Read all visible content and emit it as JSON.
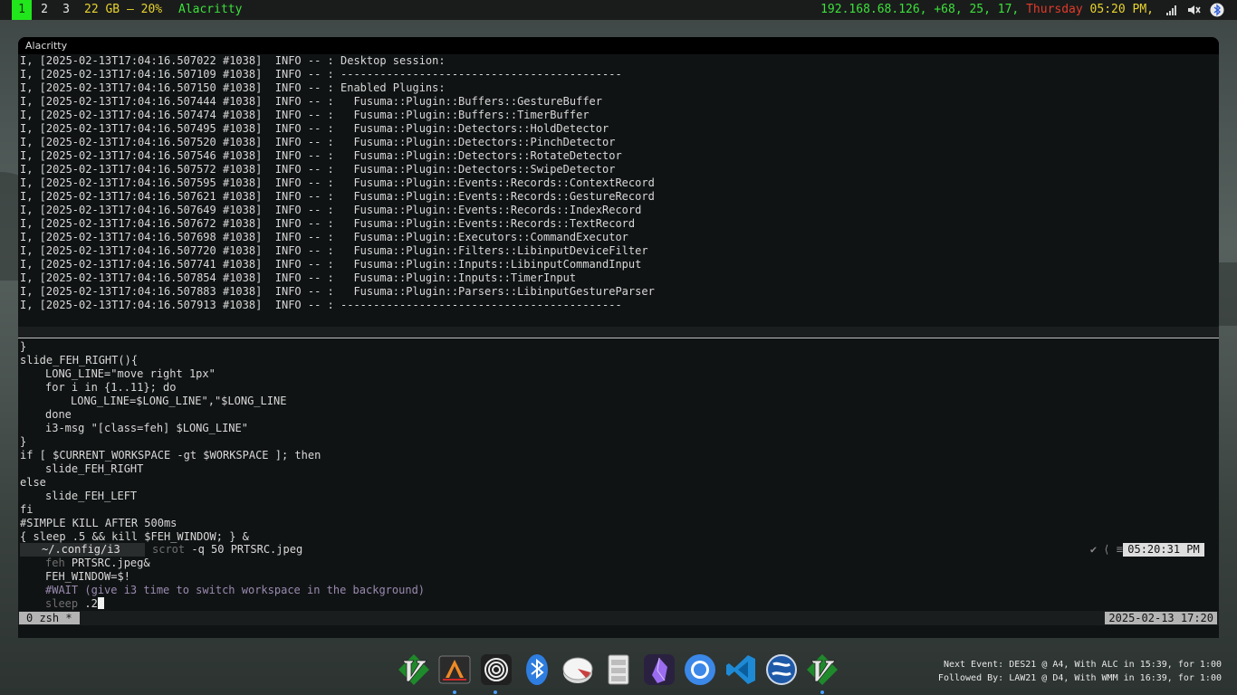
{
  "topbar": {
    "workspaces": [
      "1",
      "2",
      "3"
    ],
    "active_workspace": "1",
    "memory": "22 GB – 20%",
    "window_title": "Alacritty",
    "ip": "192.168.68.126,",
    "weather": " +68, 25, 17,",
    "day": " Thursday",
    "time": " 05:20 PM,",
    "tray_icons": [
      "signal-icon",
      "volume-muted-icon",
      "bluetooth-icon"
    ]
  },
  "window": {
    "title": "Alacritty"
  },
  "log_lines": [
    "I, [2025-02-13T17:04:16.507022 #1038]  INFO -- : Desktop session:",
    "I, [2025-02-13T17:04:16.507109 #1038]  INFO -- : -------------------------------------------",
    "I, [2025-02-13T17:04:16.507150 #1038]  INFO -- : Enabled Plugins:",
    "I, [2025-02-13T17:04:16.507444 #1038]  INFO -- :   Fusuma::Plugin::Buffers::GestureBuffer",
    "I, [2025-02-13T17:04:16.507474 #1038]  INFO -- :   Fusuma::Plugin::Buffers::TimerBuffer",
    "I, [2025-02-13T17:04:16.507495 #1038]  INFO -- :   Fusuma::Plugin::Detectors::HoldDetector",
    "I, [2025-02-13T17:04:16.507520 #1038]  INFO -- :   Fusuma::Plugin::Detectors::PinchDetector",
    "I, [2025-02-13T17:04:16.507546 #1038]  INFO -- :   Fusuma::Plugin::Detectors::RotateDetector",
    "I, [2025-02-13T17:04:16.507572 #1038]  INFO -- :   Fusuma::Plugin::Detectors::SwipeDetector",
    "I, [2025-02-13T17:04:16.507595 #1038]  INFO -- :   Fusuma::Plugin::Events::Records::ContextRecord",
    "I, [2025-02-13T17:04:16.507621 #1038]  INFO -- :   Fusuma::Plugin::Events::Records::GestureRecord",
    "I, [2025-02-13T17:04:16.507649 #1038]  INFO -- :   Fusuma::Plugin::Events::Records::IndexRecord",
    "I, [2025-02-13T17:04:16.507672 #1038]  INFO -- :   Fusuma::Plugin::Events::Records::TextRecord",
    "I, [2025-02-13T17:04:16.507698 #1038]  INFO -- :   Fusuma::Plugin::Executors::CommandExecutor",
    "I, [2025-02-13T17:04:16.507720 #1038]  INFO -- :   Fusuma::Plugin::Filters::LibinputDeviceFilter",
    "I, [2025-02-13T17:04:16.507741 #1038]  INFO -- :   Fusuma::Plugin::Inputs::LibinputCommandInput",
    "I, [2025-02-13T17:04:16.507854 #1038]  INFO -- :   Fusuma::Plugin::Inputs::TimerInput",
    "I, [2025-02-13T17:04:16.507883 #1038]  INFO -- :   Fusuma::Plugin::Parsers::LibinputGestureParser",
    "I, [2025-02-13T17:04:16.507913 #1038]  INFO -- : -------------------------------------------"
  ],
  "code_lines": [
    {
      "indent": 0,
      "text": "}"
    },
    {
      "indent": 0,
      "text": "slide_FEH_RIGHT(){"
    },
    {
      "indent": 1,
      "text": "LONG_LINE=\"move right 1px\""
    },
    {
      "indent": 1,
      "text": "for i in {1..11}; do"
    },
    {
      "indent": 2,
      "text": "LONG_LINE=$LONG_LINE\",\"$LONG_LINE"
    },
    {
      "indent": 1,
      "text": "done"
    },
    {
      "indent": 1,
      "text": "i3-msg \"[class=feh] $LONG_LINE\""
    },
    {
      "indent": 0,
      "text": "}"
    },
    {
      "indent": 0,
      "text": "if [ $CURRENT_WORKSPACE -gt $WORKSPACE ]; then"
    },
    {
      "indent": 1,
      "text": "slide_FEH_RIGHT"
    },
    {
      "indent": 0,
      "text": "else"
    },
    {
      "indent": 1,
      "text": "slide_FEH_LEFT"
    },
    {
      "indent": 0,
      "text": "fi"
    },
    {
      "indent": 0,
      "text": "#SIMPLE KILL AFTER 500ms"
    },
    {
      "indent": 0,
      "text": "{ sleep .5 && kill $FEH_WINDOW; } &"
    }
  ],
  "prompt": {
    "dir": "~/.config/i3",
    "cmd_word": "scrot",
    "cmd_args": " -q 50 PRTSRC.jpeg",
    "icons": "✔ ⟨ ≡",
    "time": "05:20:31 PM"
  },
  "continuation": {
    "line1_cmd": "feh",
    "line1_args": " PRTSRC.jpeg&",
    "line2": "FEH_WINDOW=$!",
    "line3_hash": "#WAIT",
    "line3_rest": " (give i3 time to switch workspace in the background)",
    "line4_cmd": "sleep",
    "line4_args": " .2"
  },
  "tmux": {
    "window": "0 zsh *",
    "datetime": "2025-02-13 17:20"
  },
  "dock": {
    "apps": [
      "vim-icon",
      "arch-terminal-icon",
      "target-icon",
      "bluetooth-icon",
      "disk-icon",
      "file-manager-icon",
      "obsidian-icon",
      "chromium-icon",
      "vscode-icon",
      "globe-icon",
      "vim-icon"
    ]
  },
  "events": {
    "next": "Next Event: DES21 @ A4, With ALC in 15:39, for 1:00",
    "followed": "Followed By: LAW21 @ D4, With WMM in 16:39, for 1:00"
  },
  "colors": {
    "active_ws": "#22e61c",
    "green": "#3de03a",
    "yellow": "#e8d32e",
    "red": "#e23a2a"
  }
}
